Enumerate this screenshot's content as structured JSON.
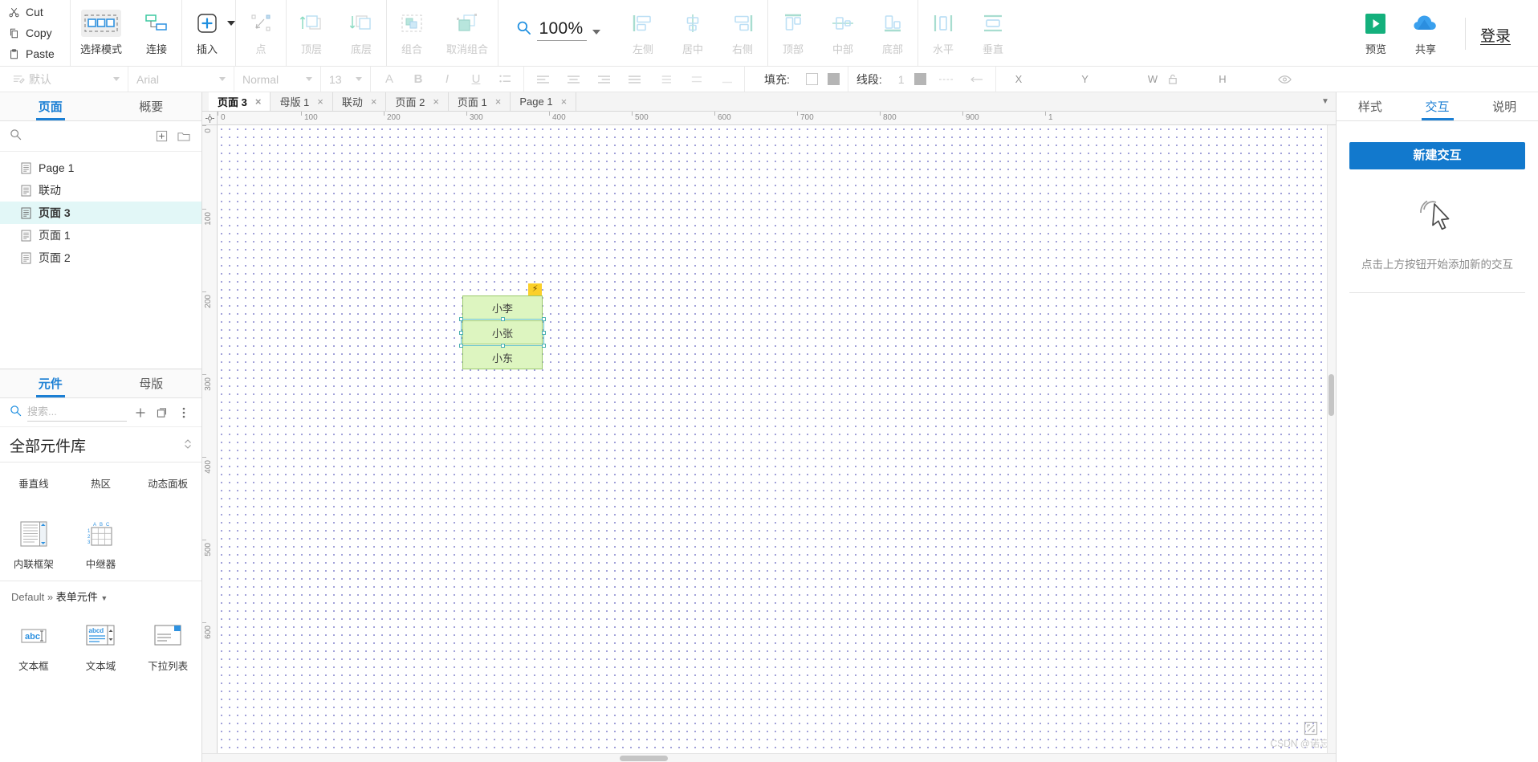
{
  "toolbar": {
    "clipboard": [
      {
        "label": "Cut",
        "icon": "scissors-icon"
      },
      {
        "label": "Copy",
        "icon": "copy-icon"
      },
      {
        "label": "Paste",
        "icon": "clipboard-icon"
      }
    ],
    "groups": [
      {
        "name": "mode",
        "buttons": [
          {
            "label": "选择模式",
            "icon": "select-mode-icon",
            "state": "selected"
          },
          {
            "label": "连接",
            "icon": "connect-icon",
            "state": "enabled"
          }
        ]
      },
      {
        "name": "insert",
        "buttons": [
          {
            "label": "插入",
            "icon": "insert-plus-icon",
            "state": "enabled"
          }
        ]
      },
      {
        "name": "point",
        "buttons": [
          {
            "label": "点",
            "icon": "point-icon",
            "state": "disabled"
          }
        ]
      },
      {
        "name": "order",
        "buttons": [
          {
            "label": "顶层",
            "icon": "bring-to-front-icon",
            "state": "disabled"
          },
          {
            "label": "底层",
            "icon": "send-to-back-icon",
            "state": "disabled"
          }
        ]
      },
      {
        "name": "group",
        "buttons": [
          {
            "label": "组合",
            "icon": "group-icon",
            "state": "disabled"
          },
          {
            "label": "取消组合",
            "icon": "ungroup-icon",
            "state": "disabled"
          }
        ]
      },
      {
        "name": "align-horizontal",
        "buttons": [
          {
            "label": "左侧",
            "icon": "align-left-icon",
            "state": "disabled"
          },
          {
            "label": "居中",
            "icon": "align-center-icon",
            "state": "disabled"
          },
          {
            "label": "右侧",
            "icon": "align-right-icon",
            "state": "disabled"
          }
        ]
      },
      {
        "name": "align-vertical",
        "buttons": [
          {
            "label": "顶部",
            "icon": "align-top-icon",
            "state": "disabled"
          },
          {
            "label": "中部",
            "icon": "align-middle-icon",
            "state": "disabled"
          },
          {
            "label": "底部",
            "icon": "align-bottom-icon",
            "state": "disabled"
          }
        ]
      },
      {
        "name": "distribute",
        "buttons": [
          {
            "label": "水平",
            "icon": "distribute-horizontal-icon",
            "state": "disabled"
          },
          {
            "label": "垂直",
            "icon": "distribute-vertical-icon",
            "state": "disabled"
          }
        ]
      }
    ],
    "zoom": {
      "icon": "magnifier-icon",
      "value": "100%"
    },
    "right": {
      "preview": {
        "label": "预览",
        "icon": "play-icon",
        "color": "#14b07c"
      },
      "share": {
        "label": "共享",
        "icon": "cloud-icon",
        "color": "#2196f3"
      },
      "signin": "登录"
    }
  },
  "format_bar": {
    "style_icon": "paragraph-style-icon",
    "style": "默认",
    "font_family": "Arial",
    "font_weight": "Normal",
    "font_size": "13",
    "text_icons": [
      "font-color-icon",
      "bold-icon",
      "italic-icon",
      "underline-icon",
      "list-icon"
    ],
    "align_icons": [
      "align-left-text-icon",
      "align-center-text-icon",
      "align-right-text-icon",
      "align-justify-text-icon",
      "line-height-icon",
      "paragraph-spacing-icon",
      "indent-icon"
    ],
    "fill_label": "填充:",
    "fill_swatches": [
      "outline-swatch",
      "solid-swatch"
    ],
    "line_label": "线段:",
    "line_width": "1",
    "line_icons": [
      "line-color-icon",
      "line-style-icon",
      "arrow-style-icon"
    ],
    "coords": {
      "x_label": "X",
      "y_label": "Y",
      "w_label": "W",
      "h_label": "H",
      "lock_icon": "lock-icon",
      "eye_icon": "visibility-icon"
    }
  },
  "left_panel": {
    "tabs": [
      {
        "label": "页面",
        "active": true
      },
      {
        "label": "概要",
        "active": false
      }
    ],
    "search_icon": "search-icon",
    "actions": [
      {
        "icon": "add-page-icon"
      },
      {
        "icon": "folder-icon"
      }
    ],
    "pages": [
      {
        "label": "Page 1",
        "icon": "page-icon",
        "active": false
      },
      {
        "label": "联动",
        "icon": "page-icon",
        "active": false
      },
      {
        "label": "页面 3",
        "icon": "page-icon",
        "active": true
      },
      {
        "label": "页面 1",
        "icon": "page-icon",
        "active": false
      },
      {
        "label": "页面 2",
        "icon": "page-icon",
        "active": false
      }
    ]
  },
  "widgets_panel": {
    "tabs": [
      {
        "label": "元件",
        "active": true
      },
      {
        "label": "母版",
        "active": false
      }
    ],
    "search_icon": "search-icon",
    "search_placeholder": "搜索...",
    "add_icon": "plus-icon",
    "copy_icon": "duplicate-icon",
    "more_icon": "more-options-icon",
    "library_title": "全部元件库",
    "library_chevron": "chevron-expand-icon",
    "row1": [
      {
        "label": "垂直线",
        "icon": "vertical-line-icon"
      },
      {
        "label": "热区",
        "icon": "hotspot-icon"
      },
      {
        "label": "动态面板",
        "icon": "dynamic-panel-icon"
      }
    ],
    "row2": [
      {
        "label": "内联框架",
        "icon": "inline-frame-icon"
      },
      {
        "label": "中继器",
        "icon": "repeater-icon"
      }
    ],
    "group_header_prefix": "Default",
    "group_header_sep": "»",
    "group_header_name": "表单元件",
    "group_header_caret": "caret-down-icon",
    "row3": [
      {
        "label": "文本框",
        "icon": "text-field-icon"
      },
      {
        "label": "文本域",
        "icon": "text-area-icon"
      },
      {
        "label": "下拉列表",
        "icon": "dropdown-list-icon"
      }
    ]
  },
  "canvas": {
    "tabs": [
      {
        "label": "页面 3",
        "active": true,
        "close": "×"
      },
      {
        "label": "母版 1",
        "active": false,
        "close": "×"
      },
      {
        "label": "联动",
        "active": false,
        "close": "×"
      },
      {
        "label": "页面 2",
        "active": false,
        "close": "×"
      },
      {
        "label": "页面 1",
        "active": false,
        "close": "×"
      },
      {
        "label": "Page 1",
        "active": false,
        "close": "×"
      }
    ],
    "tabs_overflow_icon": "chevron-down-icon",
    "ruler_corner_icon": "ruler-origin-icon",
    "ruler_h_labels": [
      "0",
      "100",
      "200",
      "300",
      "400",
      "500",
      "600",
      "700",
      "800",
      "900",
      "1"
    ],
    "ruler_v_labels": [
      "0",
      "100",
      "200",
      "300",
      "400",
      "500",
      "600"
    ],
    "widgets": [
      {
        "label": "小李"
      },
      {
        "label": "小张"
      },
      {
        "label": "小东"
      }
    ],
    "interaction_badge_icon": "lightning-bolt-icon",
    "watermark": "CSDN @诺忘",
    "corner_icon": "fit-screen-icon"
  },
  "right_panel": {
    "tabs": [
      {
        "label": "样式",
        "active": false
      },
      {
        "label": "交互",
        "active": true
      },
      {
        "label": "说明",
        "active": false
      }
    ],
    "new_interaction_button": "新建交互",
    "hint_icon": "click-cursor-icon",
    "hint_text": "点击上方按钮开始添加新的交互"
  },
  "colors": {
    "accent": "#1279cd",
    "tab_active": "#1b7fd4",
    "widget_fill": "#ddf5c0",
    "widget_border": "#9ac96b",
    "selection": "#5ac0c0",
    "badge": "#fbd02a",
    "preview_green": "#14b07c",
    "share_blue": "#2196f3"
  }
}
